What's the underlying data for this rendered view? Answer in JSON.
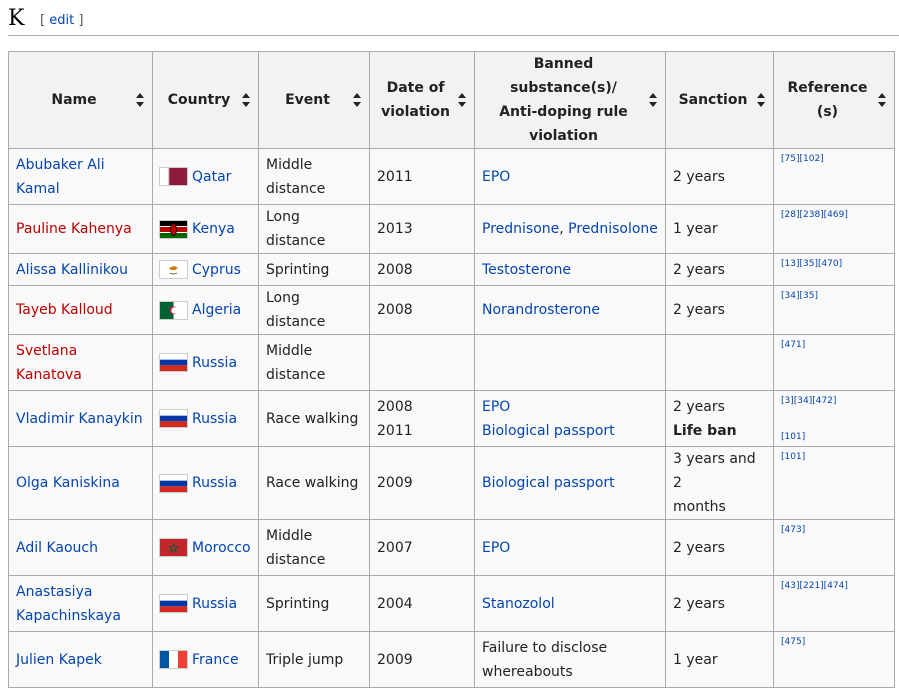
{
  "section": {
    "letter": "K",
    "edit_open": "[",
    "edit_label": "edit",
    "edit_close": "]"
  },
  "headers": {
    "name": "Name",
    "country": "Country",
    "event": "Event",
    "date_line1": "Date of",
    "date_line2": "violation",
    "sub_line1": "Banned substance(s)/",
    "sub_line2": "Anti-doping rule",
    "sub_line3": "violation",
    "sanction": "Sanction",
    "ref_line1": "Reference",
    "ref_line2": "(s)"
  },
  "rows": [
    {
      "name_line1": "Abubaker Ali",
      "name_line2": "Kamal",
      "country": "Qatar",
      "flag": "qatar",
      "event_line1": "Middle",
      "event_line2": "distance",
      "date": "2011",
      "substance": "EPO",
      "sanction": "2 years",
      "refs": "[75][102]"
    },
    {
      "name": "Pauline Kahenya",
      "country": "Kenya",
      "flag": "kenya",
      "event": "Long distance",
      "date": "2013",
      "substance_a": "Prednisone",
      "substance_sep": ", ",
      "substance_b": "Prednisolone",
      "sanction": "1 year",
      "refs": "[28][238][469]"
    },
    {
      "name": "Alissa Kallinikou",
      "country": "Cyprus",
      "flag": "cyprus",
      "event": "Sprinting",
      "date": "2008",
      "substance": "Testosterone",
      "sanction": "2 years",
      "refs": "[13][35][470]"
    },
    {
      "name": "Tayeb Kalloud",
      "country": "Algeria",
      "flag": "algeria",
      "event": "Long distance",
      "date": "2008",
      "substance": "Norandrosterone",
      "sanction": "2 years",
      "refs": "[34][35]"
    },
    {
      "name": "Svetlana Kanatova",
      "country": "Russia",
      "flag": "russia",
      "event_line1": "Middle",
      "event_line2": "distance",
      "date": "",
      "substance": "",
      "sanction": "",
      "refs": "[471]"
    },
    {
      "name": "Vladimir Kanaykin",
      "country": "Russia",
      "flag": "russia",
      "event": "Race walking",
      "date_line1": "2008",
      "date_line2": "2011",
      "substance_line1": "EPO",
      "substance_line2": "Biological passport",
      "sanction_line1": "2 years",
      "sanction_line2": "Life ban",
      "refs_line1": "[3][34][472]",
      "refs_line2": "[101]"
    },
    {
      "name": "Olga Kaniskina",
      "country": "Russia",
      "flag": "russia",
      "event": "Race walking",
      "date": "2009",
      "substance": "Biological passport",
      "sanction_line1": "3 years and 2",
      "sanction_line2": "months",
      "refs": "[101]"
    },
    {
      "name": "Adil Kaouch",
      "country": "Morocco",
      "flag": "morocco",
      "event_line1": "Middle",
      "event_line2": "distance",
      "date": "2007",
      "substance": "EPO",
      "sanction": "2 years",
      "refs": "[473]"
    },
    {
      "name_line1": "Anastasiya",
      "name_line2": "Kapachinskaya",
      "country": "Russia",
      "flag": "russia",
      "event": "Sprinting",
      "date": "2004",
      "substance": "Stanozolol",
      "sanction": "2 years",
      "refs": "[43][221][474]"
    },
    {
      "name": "Julien Kapek",
      "country": "France",
      "flag": "france",
      "event": "Triple jump",
      "date": "2009",
      "substance_line1": "Failure to disclose",
      "substance_line2": "whereabouts",
      "sanction": "1 year",
      "refs": "[475]"
    }
  ],
  "colors": {
    "link": "#0645ad",
    "redlink": "#ba0000",
    "header_bg": "#f2f2f2",
    "cell_bg": "#f9f9f9"
  }
}
